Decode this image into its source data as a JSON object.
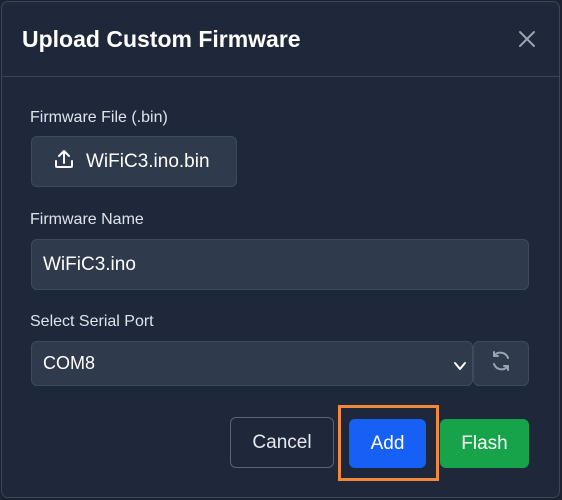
{
  "dialog": {
    "title": "Upload Custom Firmware",
    "close_icon": "close-icon"
  },
  "firmware_file": {
    "label": "Firmware File (.bin)",
    "button_text": "WiFiC3.ino.bin",
    "icon": "upload-icon"
  },
  "firmware_name": {
    "label": "Firmware Name",
    "value": "WiFiC3.ino"
  },
  "serial_port": {
    "label": "Select Serial Port",
    "selected": "COM8",
    "refresh_icon": "refresh-icon"
  },
  "actions": {
    "cancel": "Cancel",
    "add": "Add",
    "flash": "Flash"
  },
  "colors": {
    "background": "#1e283a",
    "input_bg": "#2f3a4d",
    "primary": "#1660f5",
    "success": "#17a34a",
    "highlight": "#f08a3a"
  }
}
